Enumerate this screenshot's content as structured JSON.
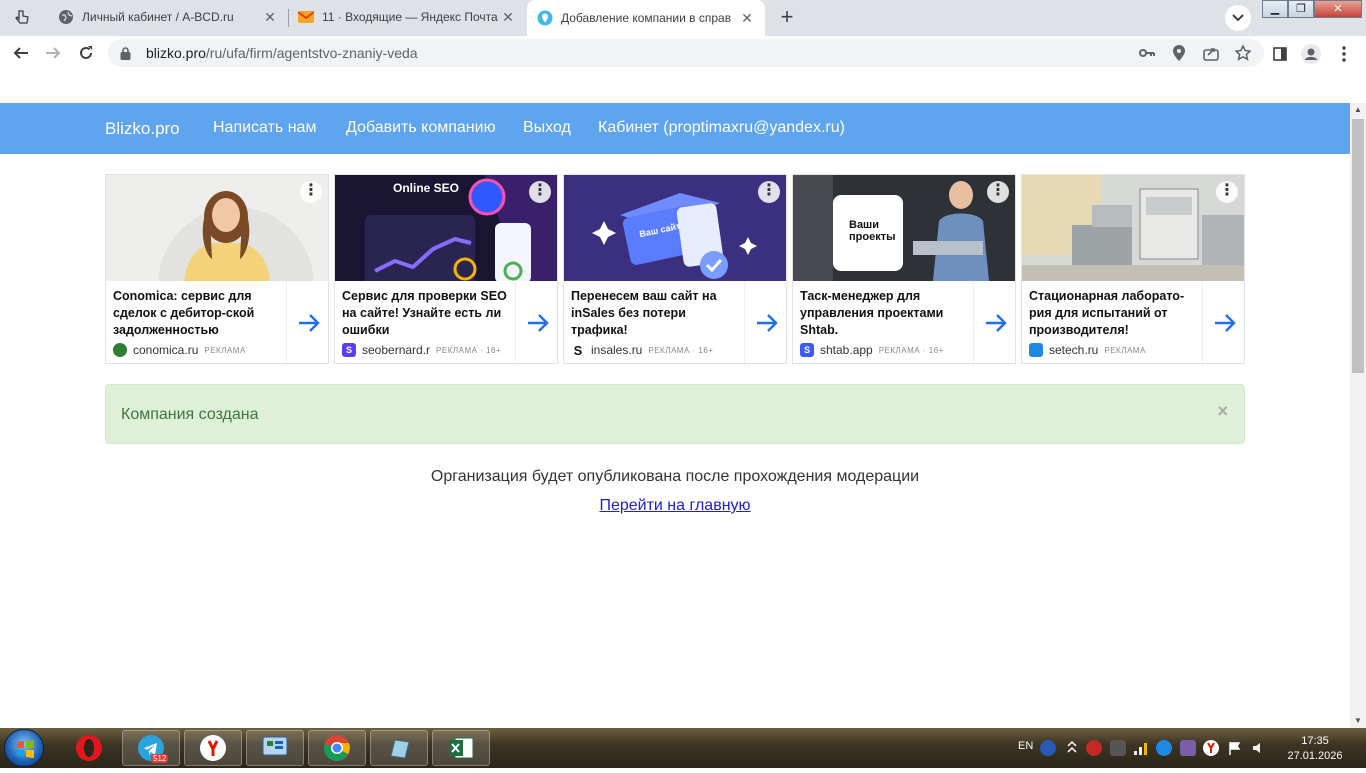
{
  "tabs": [
    {
      "title": "Личный кабинет / A-BCD.ru",
      "icon": "globe-icon"
    },
    {
      "title": "11 · Входящие — Яндекс Почта",
      "icon": "mail-icon"
    },
    {
      "title": "Добавление компании в справ",
      "icon": "location-pin-icon"
    }
  ],
  "address": {
    "host": "blizko.pro",
    "path": "/ru/ufa/firm/agentstvo-znaniy-veda"
  },
  "nav": {
    "brand": "Blizko.pro",
    "items": [
      "Написать нам",
      "Добавить компанию",
      "Выход",
      "Кабинет (proptimaxru@yandex.ru)"
    ]
  },
  "ads": [
    {
      "title": "Conomica: сервис для сделок с дебитор-ской задолженностью",
      "domain": "conomica.ru",
      "mark": "РЕКЛАМА",
      "accent": "#2e7d32"
    },
    {
      "title": "Сервис для проверки SEO на сайте! Узнайте есть ли ошибки",
      "domain": "seobernard.r",
      "mark": "РЕКЛАМА · 16+",
      "accent": "#5b3df5",
      "image_text": "Online SEO"
    },
    {
      "title": "Перенесем ваш сайт на inSales без потери трафика!",
      "domain": "insales.ru",
      "mark": "РЕКЛАМА · 16+",
      "accent": "#111111",
      "image_text": "Ваш сайт"
    },
    {
      "title": "Таск-менеджер для управления проектами Shtab.",
      "domain": "shtab.app",
      "mark": "РЕКЛАМА · 16+",
      "accent": "#3b5bfd",
      "image_text": "Ваши проекты"
    },
    {
      "title": "Стационарная лаборато-рия для испытаний от производителя!",
      "domain": "setech.ru",
      "mark": "РЕКЛАМА",
      "accent": "#1e88e5"
    }
  ],
  "alert": {
    "message": "Компания создана",
    "close": "×"
  },
  "moderation_note": "Организация будет опубликована после прохождения модерации",
  "home_link": "Перейти на главную",
  "taskbar": {
    "telegram_badge": "512",
    "lang": "EN",
    "time": "17:35",
    "date": "27.01.2026"
  }
}
